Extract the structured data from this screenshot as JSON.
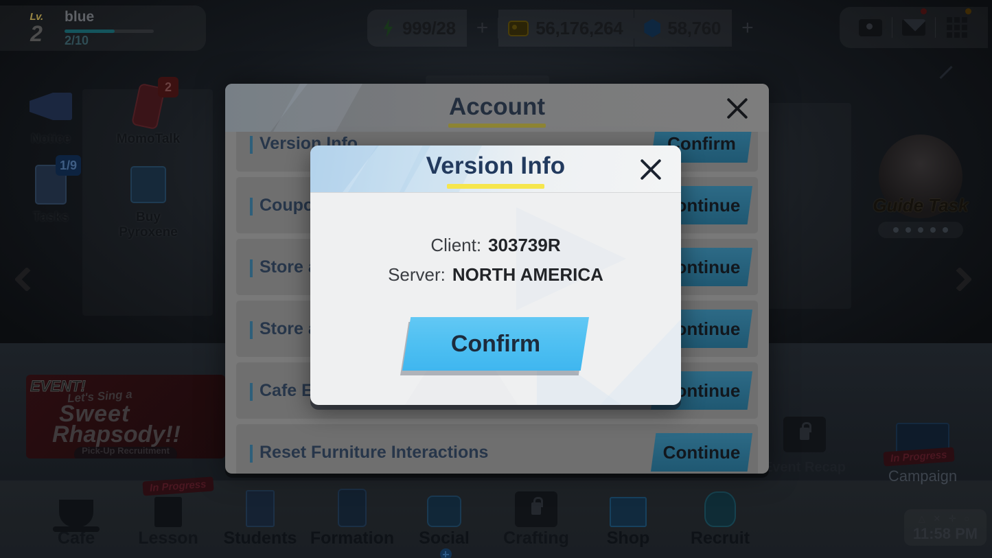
{
  "topbar": {
    "player": {
      "lv_label": "Lv.",
      "level": "2",
      "name": "blue",
      "xp": "2/10"
    },
    "currencies": [
      {
        "icon": "ap-icon",
        "value": "999/28",
        "plus": "+"
      },
      {
        "icon": "credits-coin-icon",
        "value": "56,176,264"
      },
      {
        "icon": "pyroxene-gem-icon",
        "value": "58,760",
        "plus": "+"
      }
    ],
    "right_icons": [
      {
        "name": "profile-card-icon"
      },
      {
        "name": "mail-icon"
      },
      {
        "name": "menu-grid-icon"
      }
    ]
  },
  "sidemenu": [
    {
      "label": "Notice",
      "icon": "megaphone-icon",
      "badge": ""
    },
    {
      "label": "MomoTalk",
      "icon": "phone-icon",
      "badge": "2"
    },
    {
      "label": "Tasks",
      "icon": "clipboard-icon",
      "badge": "1/9"
    },
    {
      "label": "Buy Pyroxene",
      "icon": "shopping-bag-icon",
      "badge": ""
    }
  ],
  "event_banner": {
    "tag": "EVENT!",
    "line1": "Let's Sing a",
    "line2": "Sweet",
    "line3": "Rhapsody!!",
    "pill": "Pick-Up Recruitment"
  },
  "guide_task": {
    "title": "Guide Task",
    "dots": 5
  },
  "side_tiles": [
    {
      "label": "Event Recap",
      "icon": "calendar-lock-icon",
      "badge": ""
    },
    {
      "label": "Campaign",
      "icon": "folder-icon",
      "badge": "In Progress"
    }
  ],
  "bottom_nav": [
    {
      "label": "Cafe",
      "icon": "cup-lock-icon",
      "badge": ""
    },
    {
      "label": "Lesson",
      "icon": "bag-lock-icon",
      "badge": "In Progress"
    },
    {
      "label": "Students",
      "icon": "document-icon",
      "badge": ""
    },
    {
      "label": "Formation",
      "icon": "tablet-icon",
      "badge": ""
    },
    {
      "label": "Social",
      "icon": "chat-icon",
      "badge": ""
    },
    {
      "label": "Crafting",
      "icon": "box-lock-icon",
      "badge": ""
    },
    {
      "label": "Shop",
      "icon": "store-icon",
      "badge": ""
    },
    {
      "label": "Recruit",
      "icon": "student-head-icon",
      "badge": ""
    }
  ],
  "clock": {
    "symbols": "△ ✕ ✛ ○",
    "time": "11:58 PM"
  },
  "account_dialog": {
    "title": "Account",
    "close": "close-icon",
    "rows": [
      {
        "label": "Version Info",
        "button": "Confirm"
      },
      {
        "label": "Coupon",
        "button": "Continue"
      },
      {
        "label": "Store a",
        "button": "Continue"
      },
      {
        "label": "Store a",
        "button": "Continue"
      },
      {
        "label": "Cafe Ea",
        "button": "Continue"
      },
      {
        "label": "Reset Furniture Interactions",
        "button": "Continue"
      }
    ]
  },
  "version_modal": {
    "title": "Version Info",
    "close": "close-icon",
    "client_key": "Client:",
    "client_value": "303739R",
    "server_key": "Server:",
    "server_value": "NORTH AMERICA",
    "confirm_label": "Confirm"
  },
  "colors": {
    "accent_yellow": "#f6e64d",
    "confirm_blue": "#4fc0f2",
    "title_navy": "#223a5e",
    "dialog_bg": "#eff0f1"
  }
}
